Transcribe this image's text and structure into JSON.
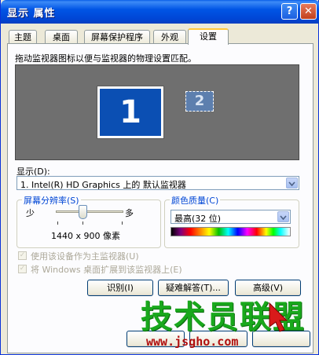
{
  "window": {
    "title": "显示 属性",
    "help_glyph": "?",
    "close_glyph": "✕"
  },
  "tabs": [
    {
      "label": "主题"
    },
    {
      "label": "桌面"
    },
    {
      "label": "屏幕保护程序"
    },
    {
      "label": "外观"
    },
    {
      "label": "设置",
      "active": true
    }
  ],
  "settings": {
    "instruction": "拖动监视器图标以便与监视器的物理设置匹配。",
    "monitor1_label": "1",
    "monitor2_label": "2",
    "display_label": "显示(D):",
    "display_value": "1. Intel(R) HD Graphics 上的 默认监视器",
    "resolution": {
      "group_title": "屏幕分辨率(S)",
      "less_label": "少",
      "more_label": "多",
      "value": "1440 x 900 像素"
    },
    "color_quality": {
      "group_title": "颜色质量(C)",
      "value": "最高(32 位)"
    },
    "checkbox_primary": {
      "label": "使用该设备作为主监视器(U)",
      "checked": true,
      "disabled": true
    },
    "checkbox_extend": {
      "label": "将 Windows 桌面扩展到该监视器上(E)",
      "checked": true,
      "disabled": true
    },
    "buttons": {
      "identify": "识别(I)",
      "troubleshoot": "疑难解答(T)...",
      "advanced": "高级(V)"
    }
  },
  "watermark": {
    "text": "技术员联盟",
    "url": "www.jsgho.com"
  },
  "colors": {
    "title_bar": "#0055e5",
    "monitor_selected": "#0b4fb3",
    "group_title": "#0046d5",
    "watermark": "#19a81c"
  }
}
